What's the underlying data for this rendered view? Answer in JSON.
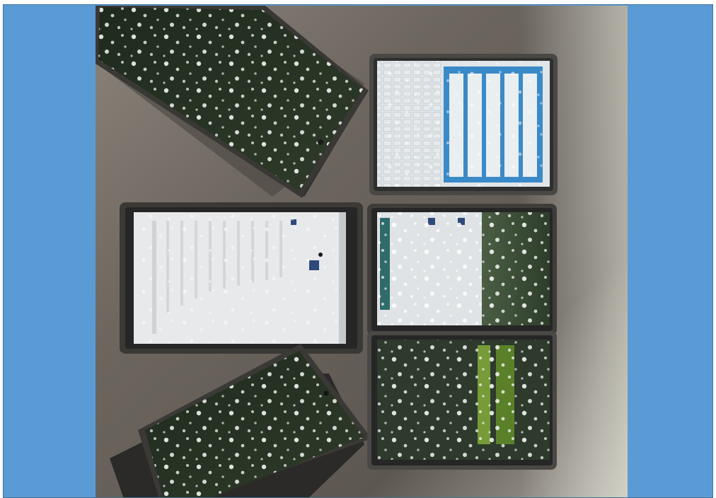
{
  "slide": {
    "background_color": "#5b9bd5",
    "border_color": "#41719c"
  },
  "photo": {
    "subject": "tablets-on-table-in-dappled-sunlight",
    "table_color": "#6d6760",
    "tablet_count": 6
  },
  "tablets": [
    {
      "id": "top-left",
      "screen": "dark-reflection"
    },
    {
      "id": "top-right",
      "screen": "blue-form-with-keyboard"
    },
    {
      "id": "middle-left",
      "screen": "white-list-menu"
    },
    {
      "id": "middle-right",
      "screen": "split-light-and-green"
    },
    {
      "id": "bottom-left",
      "screen": "dark-reflection-in-case"
    },
    {
      "id": "bottom-right",
      "screen": "green-title-splash"
    }
  ]
}
